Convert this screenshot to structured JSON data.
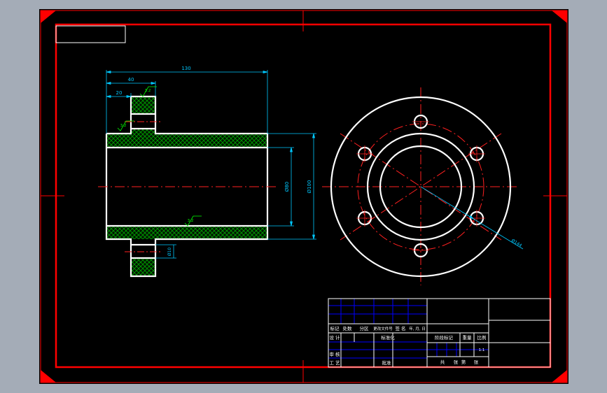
{
  "drawing": {
    "colors": {
      "background": "#000000",
      "frame": "#ff0000",
      "outline": "#ffffff",
      "dimension": "#00c8ff",
      "centerline": "#ff2020",
      "hatch": "#00a000",
      "roughness": "#00ff00",
      "title_grid": "#0000ff",
      "title_text": "#ffffff",
      "window_gray": "#a4acb7"
    },
    "dimensions": {
      "overall_length": "130",
      "flange_position": "40",
      "flange_thickness": "20",
      "bore_diameter": "Ø80",
      "outer_diameter": "Ø100",
      "step_height": "Ø10",
      "pitch_circle": "Ø144"
    },
    "roughness": {
      "flange_top": "3.2",
      "flange_face": "3.2",
      "bore_surface": "3.2"
    }
  },
  "title_block": {
    "row1": [
      "标记",
      "处数",
      "分区",
      "更改文件号",
      "签 名",
      "年, 月, 日"
    ],
    "design": "设 计",
    "standardization": "标准化",
    "stage_mark": "阶段标记",
    "weight": "重量",
    "scale": "比例",
    "scale_value": "1:1",
    "review": "审 核",
    "process": "工 艺",
    "approve": "批准",
    "sheets_total": "共",
    "sheets_label": "张",
    "sheet_no": "第",
    "sheet_label": "张"
  }
}
